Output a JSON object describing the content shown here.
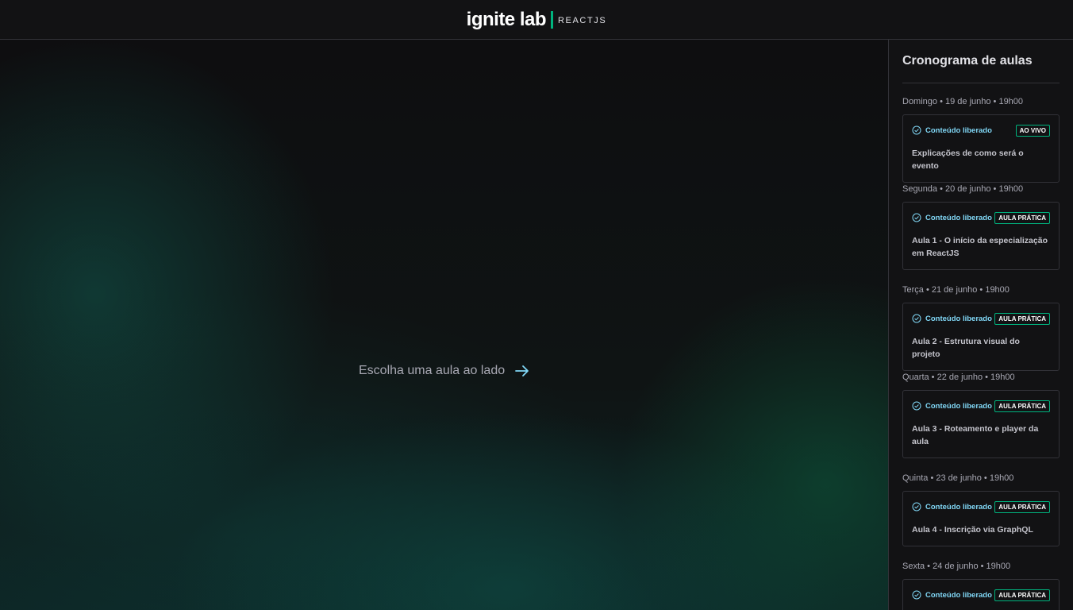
{
  "header": {
    "logo_main": "ignite lab",
    "logo_sub": "REACTJS"
  },
  "main": {
    "empty_message": "Escolha uma aula ao lado",
    "arrow_icon": "arrow-right-icon"
  },
  "sidebar": {
    "title": "Cronograma de aulas",
    "lessons": [
      {
        "date": "Domingo • 19 de junho • 19h00",
        "status": "Conteúdo liberado",
        "badge": "AO VIVO",
        "title": "Explicações de como será o evento"
      },
      {
        "date": "Segunda • 20 de junho • 19h00",
        "status": "Conteúdo liberado",
        "badge": "AULA PRÁTICA",
        "title": "Aula 1 - O início da especialização em ReactJS"
      },
      {
        "date": "Terça • 21 de junho • 19h00",
        "status": "Conteúdo liberado",
        "badge": "AULA PRÁTICA",
        "title": "Aula 2 - Estrutura visual do projeto"
      },
      {
        "date": "Quarta • 22 de junho • 19h00",
        "status": "Conteúdo liberado",
        "badge": "AULA PRÁTICA",
        "title": "Aula 3 - Roteamento e player da aula"
      },
      {
        "date": "Quinta • 23 de junho • 19h00",
        "status": "Conteúdo liberado",
        "badge": "AULA PRÁTICA",
        "title": "Aula 4 - Inscrição via GraphQL"
      },
      {
        "date": "Sexta • 24 de junho • 19h00",
        "status": "Conteúdo liberado",
        "badge": "AULA PRÁTICA",
        "title": ""
      }
    ]
  },
  "colors": {
    "background": "#121214",
    "accent_green": "#00b37e",
    "accent_blue": "#81d8f7",
    "border": "#323238"
  }
}
